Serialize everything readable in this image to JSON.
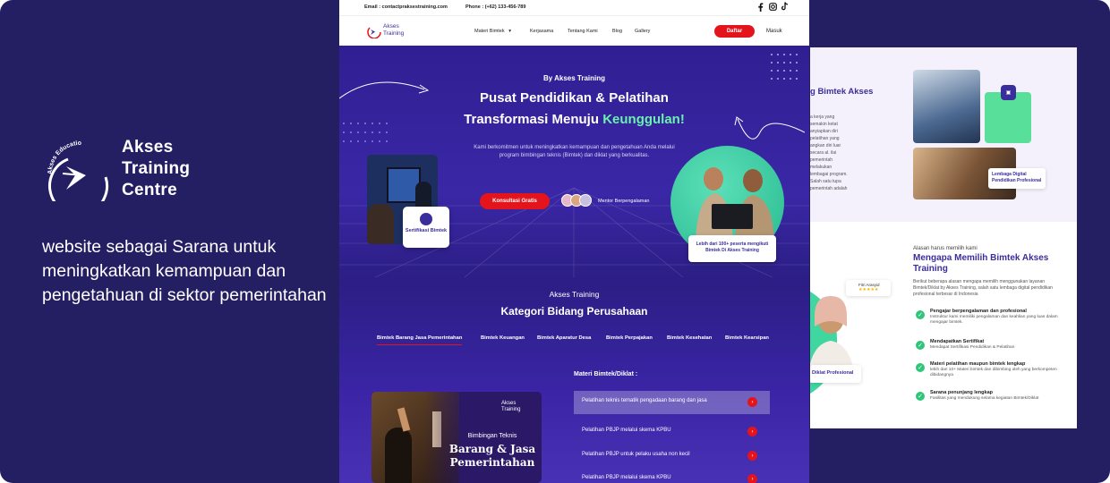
{
  "promo": {
    "logo_arc_text": "Akses Education",
    "brand_line1": "Akses",
    "brand_line2": "Training",
    "brand_line3": "Centre",
    "tagline": "website sebagai Sarana untuk meningkatkan kemampuan dan pengetahuan di sektor pemerintahan"
  },
  "topbar": {
    "email_label": "Email : contactpraksestraining.com",
    "phone_label": "Phone : (+62) 133-456-789"
  },
  "navbar": {
    "brand_line1": "Akses",
    "brand_line2": "Training",
    "items": [
      "Materi Bimtek",
      "Kerjasama",
      "Tentang Kami",
      "Blog",
      "Gallery"
    ],
    "dropdown_caret": "▾",
    "daftar": "Daftar",
    "masuk": "Masuk"
  },
  "hero": {
    "by": "By Akses Training",
    "title_line1": "Pusat Pendidikan & Pelatihan",
    "title_line2_prefix": "Transformasi  Menuju ",
    "title_line2_highlight": "Keunggulan!",
    "paragraph": "Kami berkomitmen untuk meningkatkan kemampuan dan pengetahuan Anda melalui program bimbingan teknis (Bimtek) dan diklat yang berkualitas.",
    "cta": "Konsultasi Gratis",
    "mentor_label": "Mentor Berpengalaman",
    "sertifikasi": "Sertifikasi Bimtek",
    "stat_card": "Lebih dari 100+ peserta mengikuti Bimtek Di Akses Training"
  },
  "categories": {
    "subtitle": "Akses Training",
    "title": "Kategori Bidang Perusahaan",
    "tabs": [
      "Bimtek Barang Jasa Pemerintahan",
      "Bimtek Keuangan",
      "Bimtek Aparatur Desa",
      "Bimtek Perpajakan",
      "Bimtek Kesehatan",
      "Bimtek Kearsipan"
    ],
    "materi_heading": "Materi Bimtek/Diklat :",
    "materi": [
      "Pelatihan teknis tematik pengadaan barang dan jasa",
      "Pelatihan PBJP melalui skema KPBU",
      "Pelatihan PBJP untuk pelaku usaha non kecil",
      "Pelatihan PBJP melalui skema KPBU"
    ],
    "arrow_glyph": "›",
    "card_logo_line1": "Akses",
    "card_logo_line2": "Training",
    "card_sub": "Bimbingan Teknis",
    "card_title_line1": "Barang &  Jasa",
    "card_title_line2": "Pemerintahan"
  },
  "back": {
    "heading": "g Bimtek Akses",
    "paragraph": "a kerja yang semakin ketat anyiapkan diri pelatihan yang angkan diri luar secara al. ilai pemerintah melakukan lembagai program. Salah satu tupa pemerintah adalah",
    "lembaga_card": "Lembaga Digital Pendidikan Profesional",
    "why_small": "Alasan harus memilih kami",
    "why_title": "Mengapa Memilih Bimtek Akses Training",
    "why_desc": "Berikut beberapa alasan mengapa memilih menggunakan layanan Bimtek/Diklat by Akses Training, salah satu lembaga digital pendidikan profesional terbesar di Indonesia",
    "fitri_name": "Fitri Arasyid",
    "fitri_stars": "★★★★★",
    "diklat_card": "Diklat Profesional",
    "check_glyph": "✓",
    "reasons": [
      {
        "title": "Pengajar berpengalaman dan profesional",
        "desc": "Instruktur kami memiliki pengalaman dan keahlian yang luas dalam mengajar bimtek."
      },
      {
        "title": "Mendapatkan Sertifikat",
        "desc": "Mendapat Sertifikasi Pendidikan & Pelatihan"
      },
      {
        "title": "Materi pelatihan maupun bimtek lengkap",
        "desc": "lebih dari 10+ Materi bimtek dan dibimbing oleh yang berkompeten dibidangnya"
      },
      {
        "title": "Sarana penunjang lengkap",
        "desc": "Fasilitas yang mendukung selama kegiatan Bimtek/Diklat"
      }
    ]
  },
  "colors": {
    "bg": "#241e63",
    "accent_red": "#e3141b",
    "accent_green": "#6af0b0",
    "brand_purple": "#3a2e9d"
  }
}
